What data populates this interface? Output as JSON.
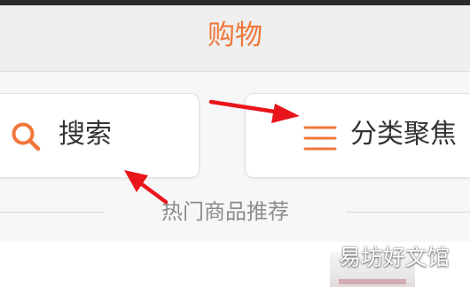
{
  "app": {
    "title": "购物"
  },
  "shortcuts": {
    "search_label": "搜索",
    "category_label": "分类聚焦"
  },
  "section": {
    "hot_title": "热门商品推荐"
  },
  "watermark": {
    "text": "易坊好文馆"
  },
  "colors": {
    "accent": "#f0773a",
    "arrow": "#e8161b"
  },
  "icons": {
    "search": "search-icon",
    "category": "menu-icon"
  }
}
